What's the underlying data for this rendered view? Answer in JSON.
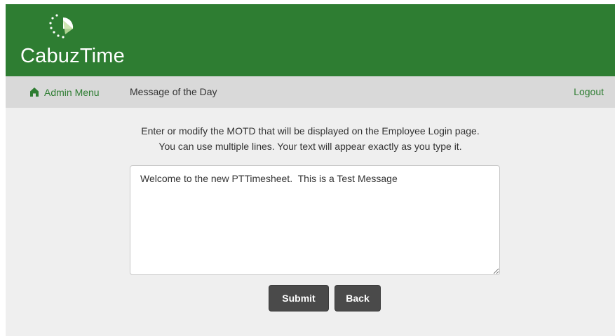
{
  "header": {
    "app_name": "CabuzTime",
    "logo_icon": "cabuztime-logo-icon",
    "brand_color": "#2e7d32"
  },
  "nav": {
    "admin_menu_label": "Admin Menu",
    "home_icon": "home-icon",
    "page_title": "Message of the Day",
    "logout_label": "Logout"
  },
  "instructions": {
    "line1": "Enter or modify the MOTD that will be displayed on the Employee Login page.",
    "line2": "You can use multiple lines. Your text will appear exactly as you type it."
  },
  "motd": {
    "value": "Welcome to the new PTTimesheet.  This is a Test Message"
  },
  "buttons": {
    "submit_label": "Submit",
    "back_label": "Back"
  }
}
